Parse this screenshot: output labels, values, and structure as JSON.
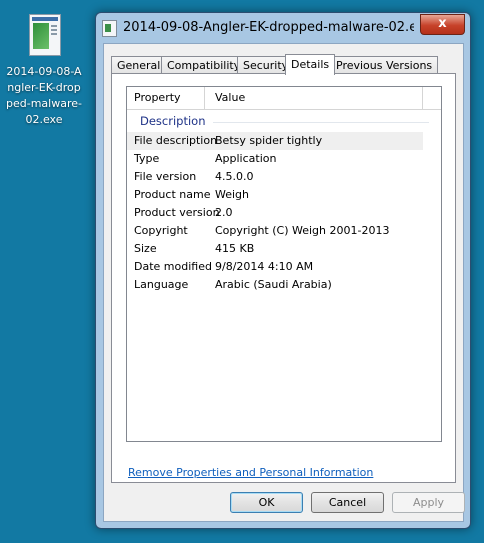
{
  "desktop_icon": {
    "label": "2014-09-08-Angler-EK-dropped-malware-02.exe"
  },
  "window": {
    "title": "2014-09-08-Angler-EK-dropped-malware-02.exe Pro...",
    "close_glyph": "x"
  },
  "tabs": [
    {
      "label": "General"
    },
    {
      "label": "Compatibility"
    },
    {
      "label": "Security"
    },
    {
      "label": "Details",
      "active": true
    },
    {
      "label": "Previous Versions"
    }
  ],
  "details": {
    "column_headers": {
      "property": "Property",
      "value": "Value"
    },
    "group": "Description",
    "rows": [
      {
        "property": "File description",
        "value": "Betsy spider tightly"
      },
      {
        "property": "Type",
        "value": "Application"
      },
      {
        "property": "File version",
        "value": "4.5.0.0"
      },
      {
        "property": "Product name",
        "value": "Weigh"
      },
      {
        "property": "Product version",
        "value": "2.0"
      },
      {
        "property": "Copyright",
        "value": "Copyright (C) Weigh 2001-2013"
      },
      {
        "property": "Size",
        "value": "415 KB"
      },
      {
        "property": "Date modified",
        "value": "9/8/2014 4:10 AM"
      },
      {
        "property": "Language",
        "value": "Arabic (Saudi Arabia)"
      }
    ]
  },
  "link": "Remove Properties and Personal Information",
  "buttons": {
    "ok": "OK",
    "cancel": "Cancel",
    "apply": "Apply"
  },
  "colors": {
    "desktop": "#1279a3",
    "link": "#0f5fbd",
    "group_header": "#1e3287"
  }
}
